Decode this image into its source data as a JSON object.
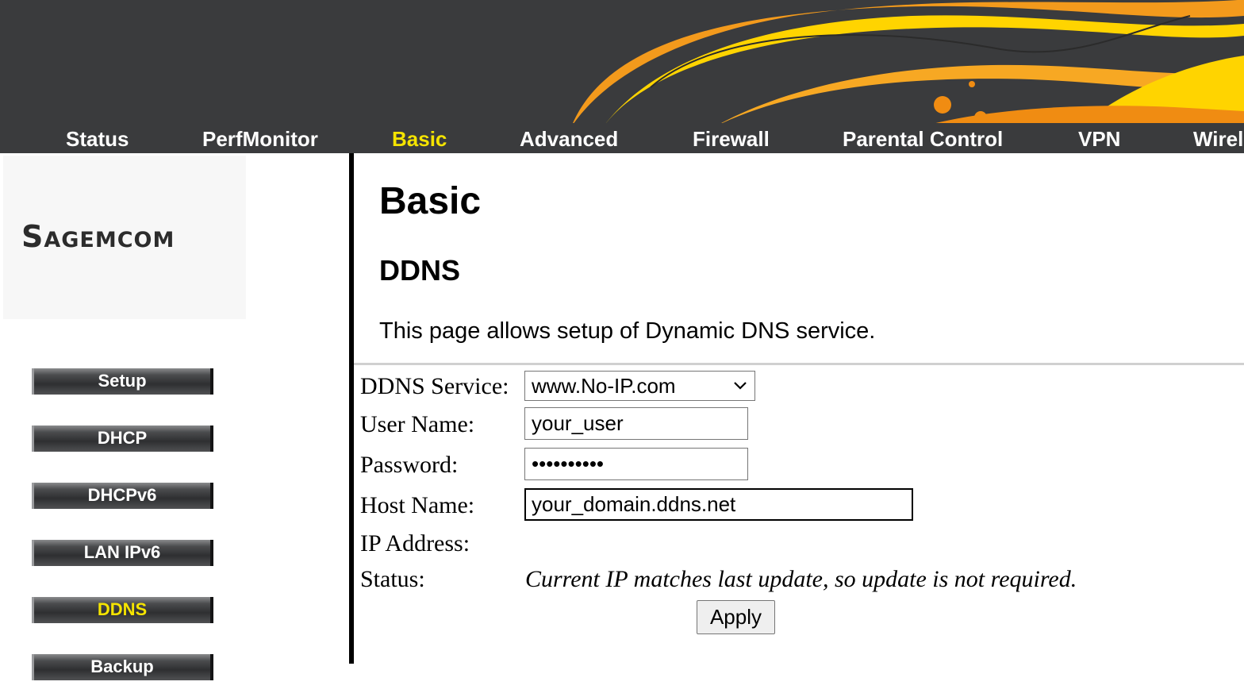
{
  "colors": {
    "header_bg": "#3a3b3d",
    "active_nav": "#f5e400",
    "accent_orange": "#f39a1c",
    "accent_yellow": "#ffd400"
  },
  "topnav": {
    "items": [
      {
        "label": "Status"
      },
      {
        "label": "PerfMonitor"
      },
      {
        "label": "Basic",
        "active": true
      },
      {
        "label": "Advanced"
      },
      {
        "label": "Firewall"
      },
      {
        "label": "Parental Control"
      },
      {
        "label": "VPN"
      },
      {
        "label": "Wirel"
      }
    ]
  },
  "logo": {
    "text": "Sagemcom"
  },
  "sidebar": {
    "items": [
      {
        "label": "Setup"
      },
      {
        "label": "DHCP"
      },
      {
        "label": "DHCPv6"
      },
      {
        "label": "LAN IPv6"
      },
      {
        "label": "DDNS",
        "active": true
      },
      {
        "label": "Backup"
      }
    ]
  },
  "main": {
    "title": "Basic",
    "section": "DDNS",
    "description": "This page allows setup of Dynamic DNS service."
  },
  "form": {
    "ddns_service": {
      "label": "DDNS Service:",
      "value": "www.No-IP.com",
      "icon": "chevron-down-icon"
    },
    "user_name": {
      "label": "User Name:",
      "value": "your_user"
    },
    "password": {
      "label": "Password:",
      "value": "••••••••••"
    },
    "host_name": {
      "label": "Host Name:",
      "value": "your_domain.ddns.net"
    },
    "ip_address": {
      "label": "IP Address:"
    },
    "status": {
      "label": "Status:",
      "value": "Current IP matches last update, so update is not required."
    },
    "apply_label": "Apply"
  }
}
